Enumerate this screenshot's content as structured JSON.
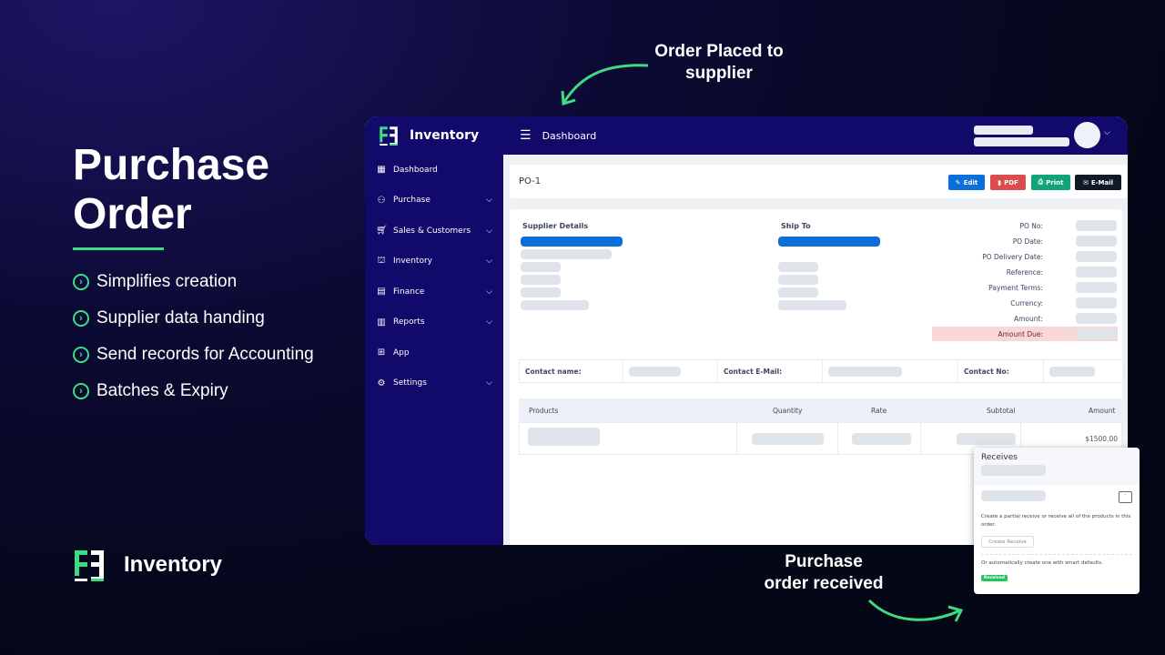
{
  "hero": {
    "title_line1": "Purchase",
    "title_line2": "Order",
    "features": [
      "Simplifies creation",
      "Supplier data handing",
      "Send records for Accounting",
      "Batches & Expiry"
    ]
  },
  "brand": {
    "name": "Inventory",
    "logo_text": "EE"
  },
  "annotations": {
    "top": [
      "Order Placed to",
      "supplier"
    ],
    "bottom": [
      "Purchase",
      "order received"
    ]
  },
  "colors": {
    "accent": "#3ddc84",
    "sidebar": "#120a6a",
    "edit": "#0a6fd8",
    "pdf": "#dc4c4c",
    "print": "#12a37a",
    "email": "#111827"
  },
  "app": {
    "brand": "Inventory",
    "header_title": "Dashboard",
    "sidebar": [
      {
        "label": "Dashboard",
        "icon": "dashboard-icon",
        "chev": false
      },
      {
        "label": "Purchase",
        "icon": "users-icon",
        "chev": true
      },
      {
        "label": "Sales & Customers",
        "icon": "cart-icon",
        "chev": true
      },
      {
        "label": "Inventory",
        "icon": "warehouse-icon",
        "chev": true
      },
      {
        "label": "Finance",
        "icon": "finance-icon",
        "chev": true
      },
      {
        "label": "Reports",
        "icon": "chart-icon",
        "chev": true
      },
      {
        "label": "App",
        "icon": "grid-icon",
        "chev": false
      },
      {
        "label": "Settings",
        "icon": "gear-icon",
        "chev": true
      }
    ],
    "po_title": "PO-1",
    "buttons": {
      "edit": "Edit",
      "pdf": "PDF",
      "print": "Print",
      "email": "E-Mail"
    },
    "supplier_heading": "Supplier Details",
    "ship_heading": "Ship To",
    "meta": [
      "PO No:",
      "PO Date:",
      "PO Delivery Date:",
      "Reference:",
      "Payment Terms:",
      "Currency:",
      "Amount:",
      "Amount Due:"
    ],
    "contact": {
      "name": "Contact name:",
      "email": "Contact E-Mail:",
      "phone": "Contact No:"
    },
    "table": {
      "headers": [
        "Products",
        "Quantity",
        "Rate",
        "Subtotal",
        "Amount"
      ],
      "rows": [
        {
          "amount": "$1500.00"
        }
      ]
    }
  },
  "receives": {
    "title": "Receives",
    "desc": "Create a partial receive or receive all of the products in this order.",
    "button": "Create Receive",
    "auto": "Or automatically create one with smart defaults.",
    "badge": "Received"
  }
}
